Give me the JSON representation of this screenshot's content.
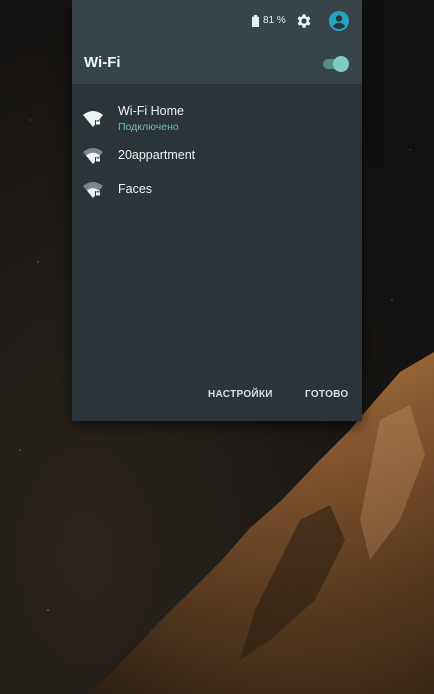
{
  "status_bar": {
    "battery_percent": "81 %",
    "battery_icon": "battery-icon",
    "settings_icon": "gear-icon",
    "account_icon": "account-circle-icon",
    "accent_color": "#26a4c4"
  },
  "wifi": {
    "title": "Wi-Fi",
    "enabled": true,
    "toggle_color": "#80cbc4",
    "networks": [
      {
        "name": "Wi-Fi Home",
        "status": "Подключено",
        "icon": "wifi-lock-icon"
      },
      {
        "name": "20appartment",
        "status": "",
        "icon": "wifi-lock-icon"
      },
      {
        "name": "Faces",
        "status": "",
        "icon": "wifi-lock-icon"
      }
    ]
  },
  "actions": {
    "settings_label": "НАСТРОЙКИ",
    "done_label": "ГОТОВО"
  }
}
